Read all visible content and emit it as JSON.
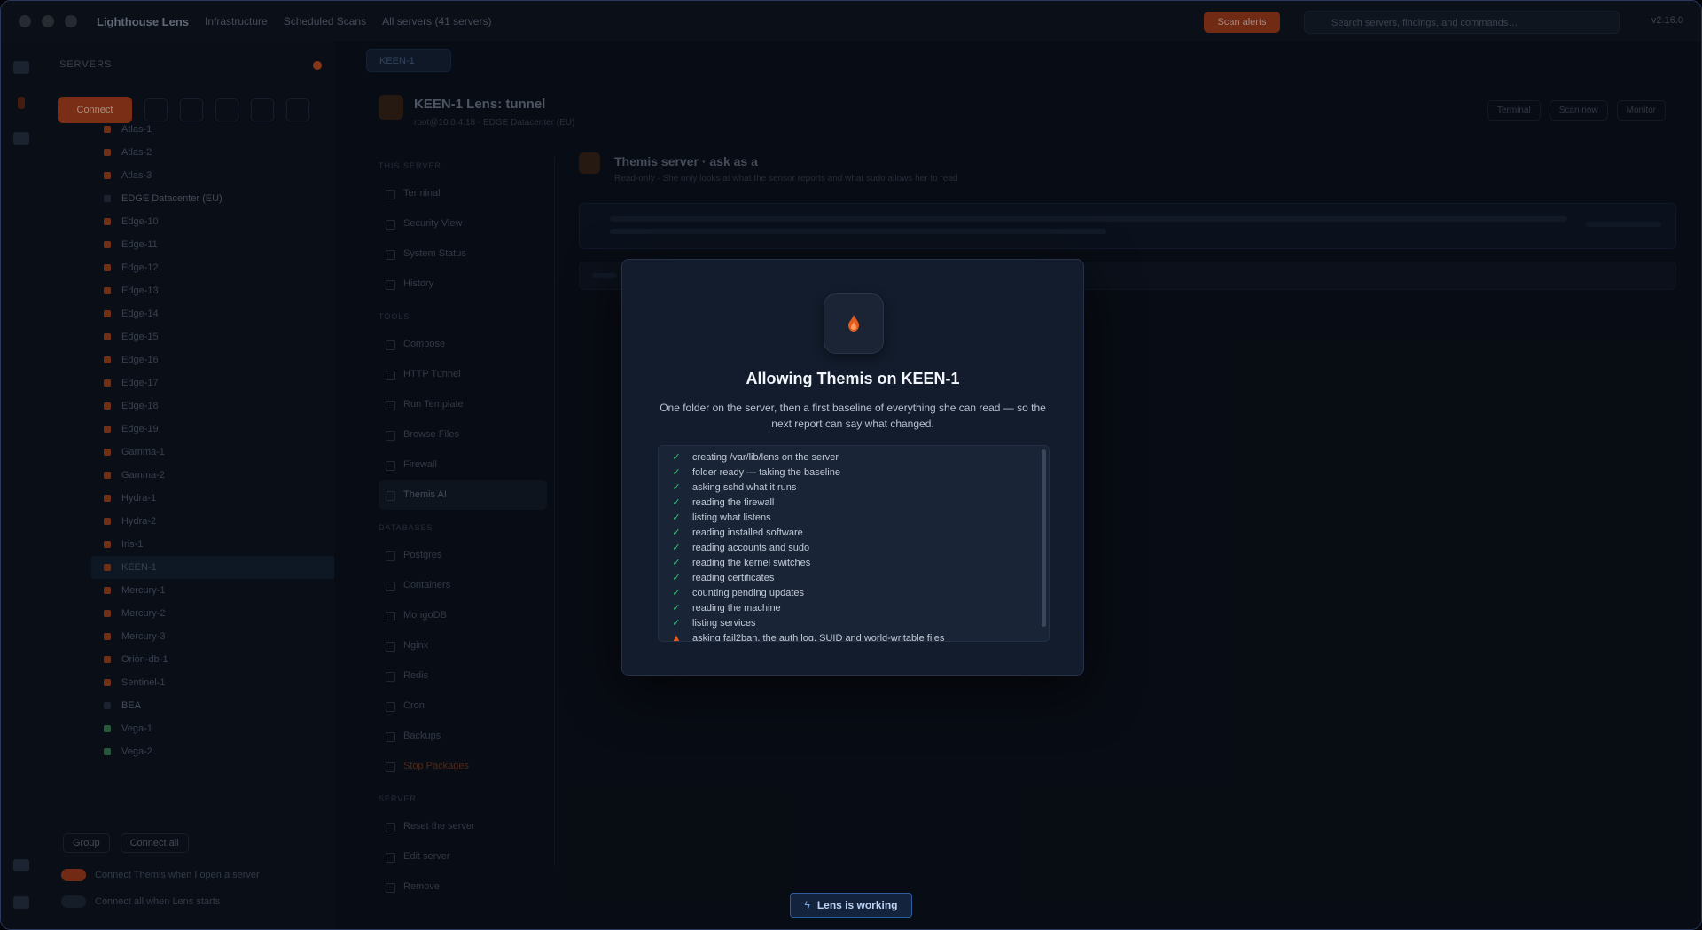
{
  "app": {
    "brand": "Lighthouse Lens",
    "breadcrumbs": [
      "Infrastructure",
      "Scheduled Scans",
      "All servers (41 servers)"
    ],
    "alert_label": "Scan alerts",
    "search_placeholder": "Search servers, findings, and commands…",
    "version": "v2.16.0"
  },
  "sidebar": {
    "heading": "SERVERS",
    "connect_label": "Connect",
    "servers": [
      {
        "name": "Atlas-1",
        "kind": "server"
      },
      {
        "name": "Atlas-2",
        "kind": "server"
      },
      {
        "name": "Atlas-3",
        "kind": "server"
      },
      {
        "name": "EDGE Datacenter (EU)",
        "kind": "group"
      },
      {
        "name": "Edge-10",
        "kind": "server"
      },
      {
        "name": "Edge-11",
        "kind": "server"
      },
      {
        "name": "Edge-12",
        "kind": "server"
      },
      {
        "name": "Edge-13",
        "kind": "server"
      },
      {
        "name": "Edge-14",
        "kind": "server"
      },
      {
        "name": "Edge-15",
        "kind": "server"
      },
      {
        "name": "Edge-16",
        "kind": "server"
      },
      {
        "name": "Edge-17",
        "kind": "server"
      },
      {
        "name": "Edge-18",
        "kind": "server"
      },
      {
        "name": "Edge-19",
        "kind": "server"
      },
      {
        "name": "Gamma-1",
        "kind": "server"
      },
      {
        "name": "Gamma-2",
        "kind": "server"
      },
      {
        "name": "Hydra-1",
        "kind": "server"
      },
      {
        "name": "Hydra-2",
        "kind": "server"
      },
      {
        "name": "Iris-1",
        "kind": "server"
      },
      {
        "name": "KEEN-1",
        "kind": "selected"
      },
      {
        "name": "Mercury-1",
        "kind": "server"
      },
      {
        "name": "Mercury-2",
        "kind": "server"
      },
      {
        "name": "Mercury-3",
        "kind": "server"
      },
      {
        "name": "Orion-db-1",
        "kind": "server"
      },
      {
        "name": "Sentinel-1",
        "kind": "server"
      },
      {
        "name": "BEA",
        "kind": "group"
      },
      {
        "name": "Vega-1",
        "kind": "green"
      },
      {
        "name": "Vega-2",
        "kind": "green"
      }
    ],
    "group_label": "Group",
    "connect_all_label": "Connect all",
    "toggle1_label": "Connect Themis when I open a server",
    "toggle2_label": "Connect all when Lens starts"
  },
  "main": {
    "tab_label": "KEEN-1",
    "host_title": "KEEN-1 Lens: tunnel",
    "host_sub": "root@10.0.4.18 · EDGE Datacenter (EU)",
    "actions": [
      "Terminal",
      "Scan now",
      "Monitor"
    ],
    "subnav_groups": [
      {
        "title": "THIS SERVER",
        "items": [
          {
            "label": "Terminal"
          },
          {
            "label": "Security View"
          },
          {
            "label": "System Status"
          },
          {
            "label": "History"
          }
        ]
      },
      {
        "title": "TOOLS",
        "items": [
          {
            "label": "Compose"
          },
          {
            "label": "HTTP Tunnel"
          },
          {
            "label": "Run Template"
          },
          {
            "label": "Browse Files"
          },
          {
            "label": "Firewall"
          },
          {
            "label": "Themis AI",
            "active": true
          }
        ]
      },
      {
        "title": "DATABASES",
        "items": [
          {
            "label": "Postgres"
          },
          {
            "label": "Containers"
          },
          {
            "label": "MongoDB"
          },
          {
            "label": "Nginx"
          },
          {
            "label": "Redis"
          },
          {
            "label": "Cron"
          },
          {
            "label": "Backups"
          },
          {
            "label": "Stop Packages",
            "warn": true
          }
        ]
      },
      {
        "title": "SERVER",
        "items": [
          {
            "label": "Reset the server"
          },
          {
            "label": "Edit server"
          },
          {
            "label": "Remove"
          }
        ]
      }
    ],
    "content_title": "Themis server · ask as a",
    "content_sub": "Read-only · She only looks at what the sensor reports and what sudo allows her to read"
  },
  "modal": {
    "title": "Allowing Themis on KEEN-1",
    "description": "One folder on the server, then a first baseline of everything she can read — so the next report can say what changed.",
    "steps": [
      {
        "label": "creating /var/lib/lens on the server",
        "status": "done"
      },
      {
        "label": "folder ready — taking the baseline",
        "status": "done"
      },
      {
        "label": "asking sshd what it runs",
        "status": "done"
      },
      {
        "label": "reading the firewall",
        "status": "done"
      },
      {
        "label": "listing what listens",
        "status": "done"
      },
      {
        "label": "reading installed software",
        "status": "done"
      },
      {
        "label": "reading accounts and sudo",
        "status": "done"
      },
      {
        "label": "reading the kernel switches",
        "status": "done"
      },
      {
        "label": "reading certificates",
        "status": "done"
      },
      {
        "label": "counting pending updates",
        "status": "done"
      },
      {
        "label": "reading the machine",
        "status": "done"
      },
      {
        "label": "listing services",
        "status": "done"
      },
      {
        "label": "asking fail2ban, the auth log, SUID and world-writable files",
        "status": "running"
      }
    ]
  },
  "toast": {
    "label": "Lens is working"
  },
  "colors": {
    "accent": "#e25a1e",
    "success": "#36c07a",
    "modal_bg": "#121c2c",
    "toast_border": "#2f5c9e"
  }
}
